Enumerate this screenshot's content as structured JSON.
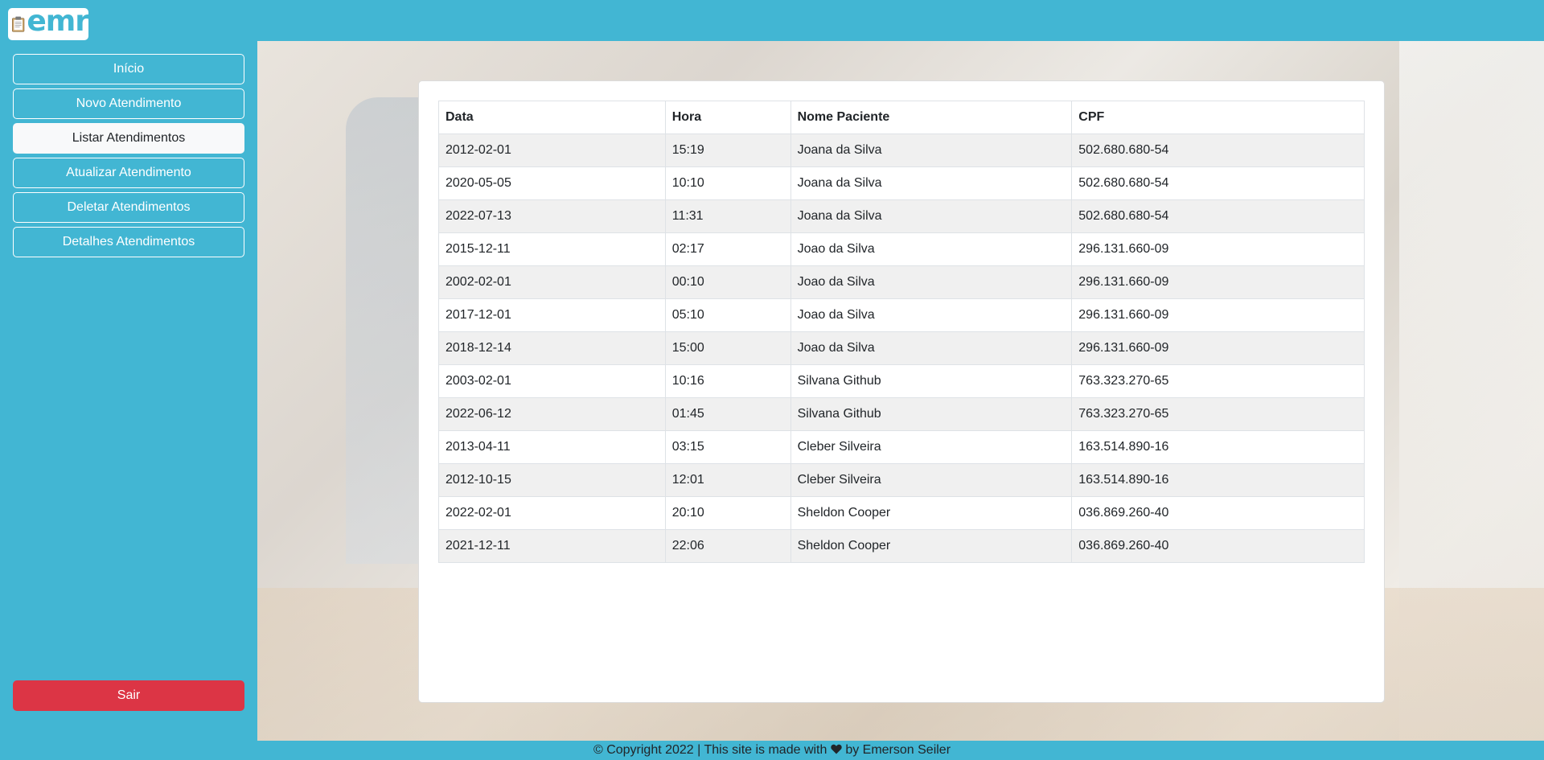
{
  "logo": {
    "text": "emr"
  },
  "sidebar": {
    "items": [
      {
        "label": "Início",
        "name": "sidebar-item-inicio",
        "active": false
      },
      {
        "label": "Novo Atendimento",
        "name": "sidebar-item-novo-atendimento",
        "active": false
      },
      {
        "label": "Listar Atendimentos",
        "name": "sidebar-item-listar-atendimentos",
        "active": true
      },
      {
        "label": "Atualizar Atendimento",
        "name": "sidebar-item-atualizar-atendimento",
        "active": false
      },
      {
        "label": "Deletar Atendimentos",
        "name": "sidebar-item-deletar-atendimentos",
        "active": false
      },
      {
        "label": "Detalhes Atendimentos",
        "name": "sidebar-item-detalhes-atendimentos",
        "active": false
      }
    ],
    "logout_label": "Sair"
  },
  "table": {
    "headers": [
      "Data",
      "Hora",
      "Nome Paciente",
      "CPF"
    ],
    "rows": [
      [
        "2012-02-01",
        "15:19",
        "Joana da Silva",
        "502.680.680-54"
      ],
      [
        "2020-05-05",
        "10:10",
        "Joana da Silva",
        "502.680.680-54"
      ],
      [
        "2022-07-13",
        "11:31",
        "Joana da Silva",
        "502.680.680-54"
      ],
      [
        "2015-12-11",
        "02:17",
        "Joao da Silva",
        "296.131.660-09"
      ],
      [
        "2002-02-01",
        "00:10",
        "Joao da Silva",
        "296.131.660-09"
      ],
      [
        "2017-12-01",
        "05:10",
        "Joao da Silva",
        "296.131.660-09"
      ],
      [
        "2018-12-14",
        "15:00",
        "Joao da Silva",
        "296.131.660-09"
      ],
      [
        "2003-02-01",
        "10:16",
        "Silvana Github",
        "763.323.270-65"
      ],
      [
        "2022-06-12",
        "01:45",
        "Silvana Github",
        "763.323.270-65"
      ],
      [
        "2013-04-11",
        "03:15",
        "Cleber Silveira",
        "163.514.890-16"
      ],
      [
        "2012-10-15",
        "12:01",
        "Cleber Silveira",
        "163.514.890-16"
      ],
      [
        "2022-02-01",
        "20:10",
        "Sheldon Cooper",
        "036.869.260-40"
      ],
      [
        "2021-12-11",
        "22:06",
        "Sheldon Cooper",
        "036.869.260-40"
      ]
    ]
  },
  "footer": {
    "text_before": "© Copyright 2022 | This site is made with",
    "text_after": "by Emerson Seiler"
  },
  "colors": {
    "brand": "#42b6d3",
    "danger": "#dc3545",
    "active_bg": "#f8f9fa"
  }
}
